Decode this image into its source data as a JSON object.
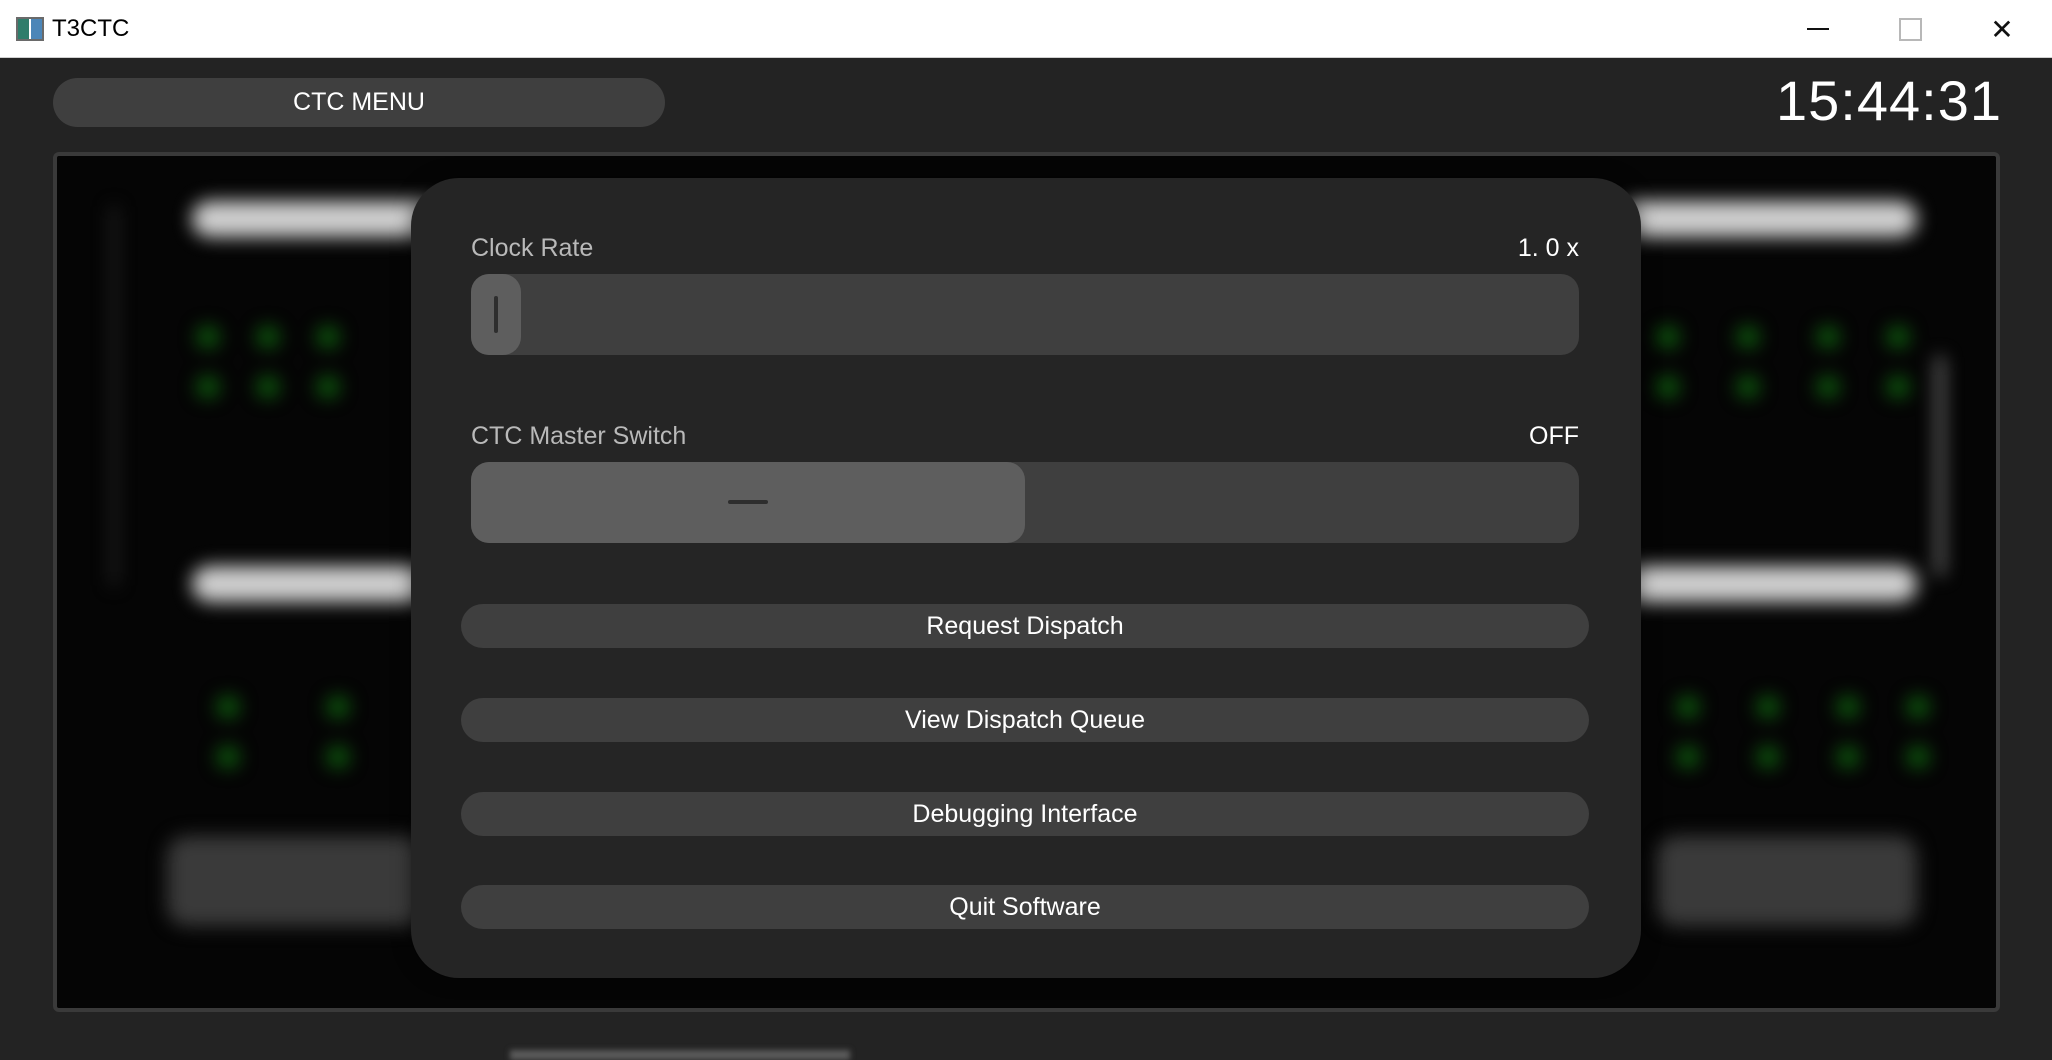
{
  "window": {
    "title": "T3CTC",
    "controls": [
      "minimize",
      "maximize",
      "close"
    ]
  },
  "header": {
    "menu_label": "CTC MENU",
    "clock": "15:44:31"
  },
  "modal": {
    "clock_rate": {
      "label": "Clock Rate",
      "value_text": "1. 0 x",
      "slider_fraction": 0.0
    },
    "master_switch": {
      "label": "CTC Master Switch",
      "state_text": "OFF"
    },
    "buttons": [
      {
        "label": "Request Dispatch"
      },
      {
        "label": "View Dispatch Queue"
      },
      {
        "label": "Debugging Interface"
      },
      {
        "label": "Quit Software"
      }
    ]
  },
  "colors": {
    "background": "#232323",
    "control": "#3f3f3f",
    "knob": "#5e5e5e",
    "modal": "#252525",
    "status_green": "#0e5e0e"
  }
}
